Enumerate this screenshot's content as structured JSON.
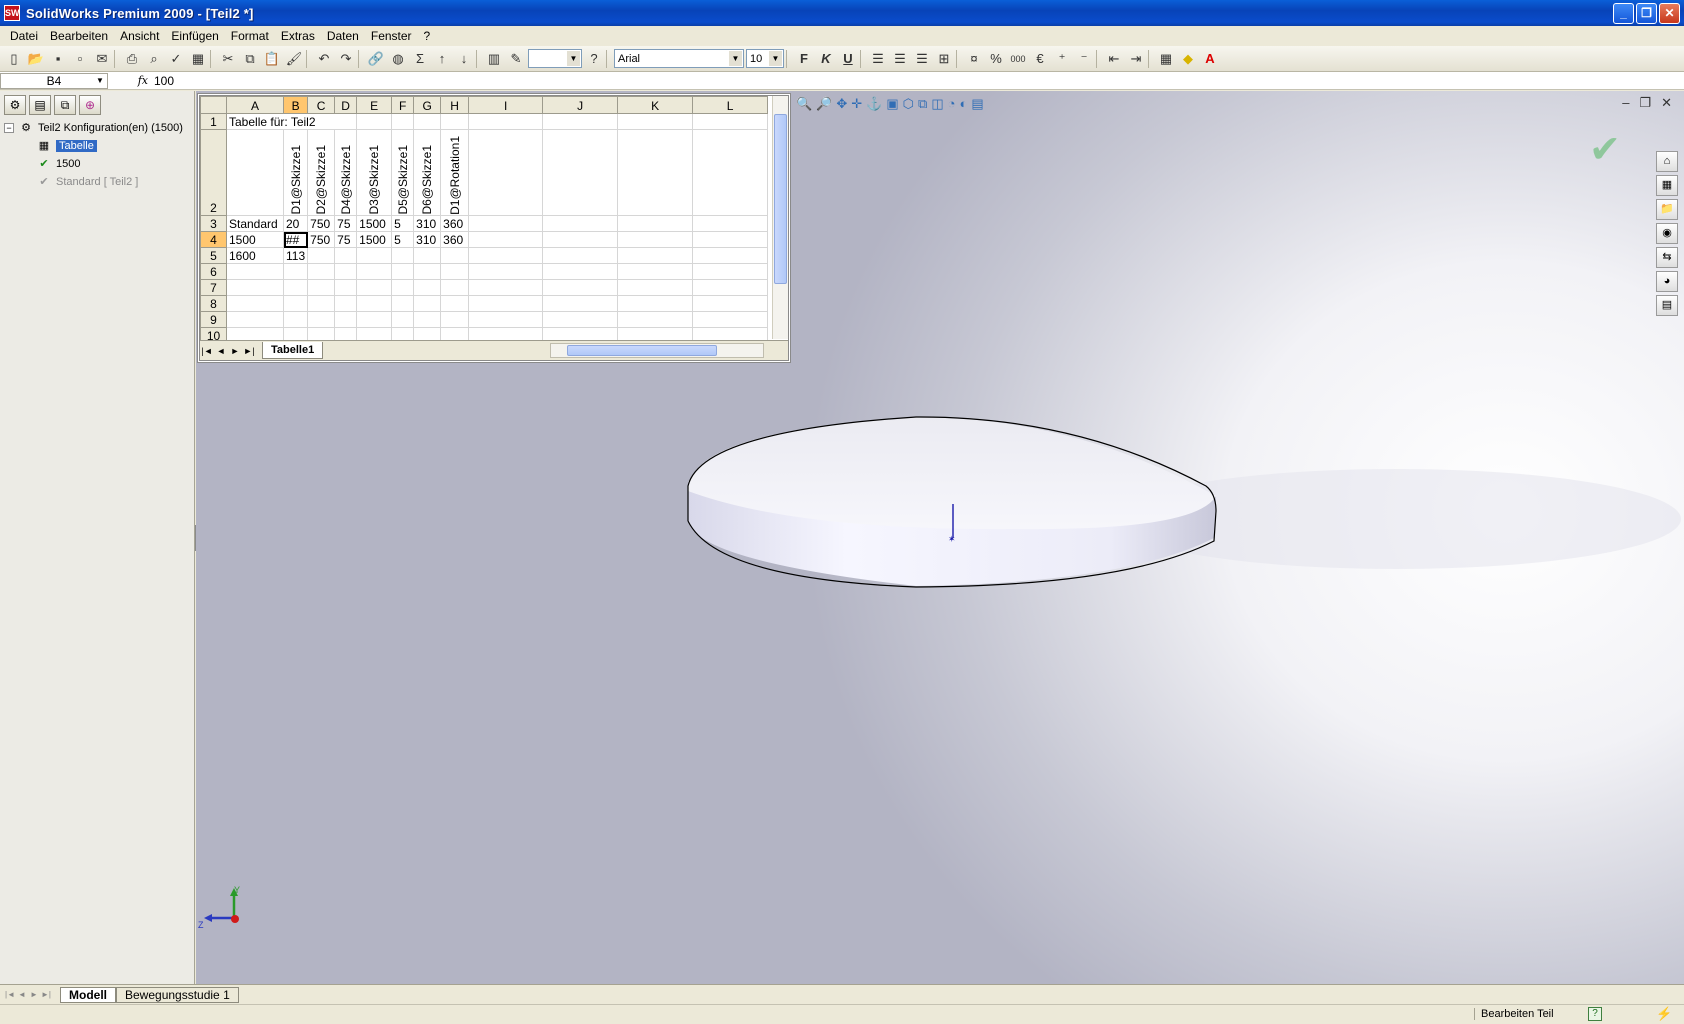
{
  "window": {
    "title": "SolidWorks Premium 2009 - [Teil2 *]",
    "app_icon_text": "SW",
    "controls": [
      "_",
      "❐",
      "✕"
    ]
  },
  "menu": [
    "Datei",
    "Bearbeiten",
    "Ansicht",
    "Einfügen",
    "Format",
    "Extras",
    "Daten",
    "Fenster",
    "?"
  ],
  "toolbar": {
    "font_name": "Arial",
    "font_size": "10",
    "bold": "F",
    "italic": "K",
    "underline": "U",
    "percent": "%",
    "thousands": "000",
    "euro": "€"
  },
  "formula_bar": {
    "name_box": "B4",
    "fx": "fx",
    "value": "100"
  },
  "feature_tree": {
    "root": "Teil2 Konfiguration(en)  (1500)",
    "items": [
      {
        "label": "Tabelle",
        "selected": true
      },
      {
        "label": "1500",
        "selected": false
      },
      {
        "label": "Standard [ Teil2 ]",
        "selected": false,
        "muted": true
      }
    ]
  },
  "spreadsheet": {
    "column_headers": [
      "A",
      "B",
      "C",
      "D",
      "E",
      "F",
      "G",
      "H",
      "I",
      "J",
      "K",
      "L"
    ],
    "active_column": "B",
    "active_row": "4",
    "row_numbers": [
      "1",
      "2",
      "3",
      "4",
      "5",
      "6",
      "7",
      "8",
      "9",
      "10"
    ],
    "title_cell": "Tabelle für: Teil2",
    "parameter_headers": [
      "D1@Skizze1",
      "D2@Skizze1",
      "D4@Skizze1",
      "D3@Skizze1",
      "D5@Skizze1",
      "D6@Skizze1",
      "D1@Rotation1"
    ],
    "rows": [
      {
        "config": "Standard",
        "values": [
          "20",
          "750",
          "75",
          "1500",
          "5",
          "310",
          "360"
        ]
      },
      {
        "config": "1500",
        "values": [
          "##",
          "750",
          "75",
          "1500",
          "5",
          "310",
          "360"
        ]
      },
      {
        "config": "1600",
        "values": [
          "113",
          "",
          "",
          "",
          "",
          "",
          ""
        ]
      }
    ],
    "sheet_tab": "Tabelle1",
    "sheet_nav": [
      "|◄",
      "◄",
      "►",
      "►|"
    ]
  },
  "viewport": {
    "view_tools": [
      "🔍",
      "🔎",
      "✥",
      "✛",
      "⚓",
      "▣",
      "⬡",
      "⧉",
      "◫",
      "◔",
      "◐",
      "▤"
    ],
    "window_controls": [
      "–",
      "❐",
      "✕"
    ],
    "confirm_icon": "✔",
    "triad_axes": {
      "y": "Y",
      "z": "Z"
    }
  },
  "task_pane_icons": [
    "⌂",
    "▦",
    "📁",
    "◉",
    "⇆",
    "◕",
    "▤"
  ],
  "bottom_tabs": [
    "Modell",
    "Bewegungsstudie 1"
  ],
  "status": {
    "mode": "Bearbeiten Teil",
    "help": "?"
  }
}
